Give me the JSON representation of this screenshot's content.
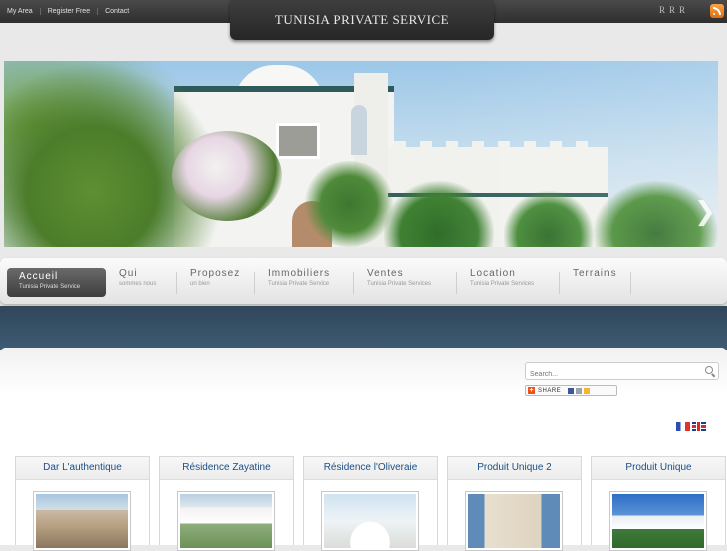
{
  "topbar": {
    "links": [
      "My Area",
      "Register Free",
      "Contact"
    ],
    "brand": "TUNISIA PRIVATE SERVICE",
    "text_size_controls": [
      "R",
      "R",
      "R"
    ]
  },
  "hero": {
    "next_arrow": "❯"
  },
  "nav": [
    {
      "title": "Accueil",
      "sub": "Tunisia Private Service"
    },
    {
      "title": "Qui",
      "sub": "sommes nous"
    },
    {
      "title": "Proposez",
      "sub": "un bien"
    },
    {
      "title": "Immobiliers",
      "sub": "Tunisia Private Service"
    },
    {
      "title": "Ventes",
      "sub": "Tunisia Private Services"
    },
    {
      "title": "Location",
      "sub": "Tunisia Private Services"
    },
    {
      "title": "Terrains",
      "sub": ""
    }
  ],
  "search": {
    "placeholder": "Search..."
  },
  "share": {
    "label": "SHARE"
  },
  "cards": [
    {
      "title": "Dar L'authentique"
    },
    {
      "title": "Résidence Zayatine"
    },
    {
      "title": "Résidence l'Oliveraie"
    },
    {
      "title": "Produit Unique 2"
    },
    {
      "title": "Produit Unique"
    }
  ],
  "colors": {
    "topbar": "#2e2e2e",
    "band": "#3e5b73",
    "card_title": "#1a4f86",
    "rss": "#e06d10"
  },
  "icons": [
    "rss-icon",
    "search-icon",
    "next-arrow-icon",
    "flag-fr-icon",
    "flag-uk-icon",
    "share-plus-icon"
  ]
}
